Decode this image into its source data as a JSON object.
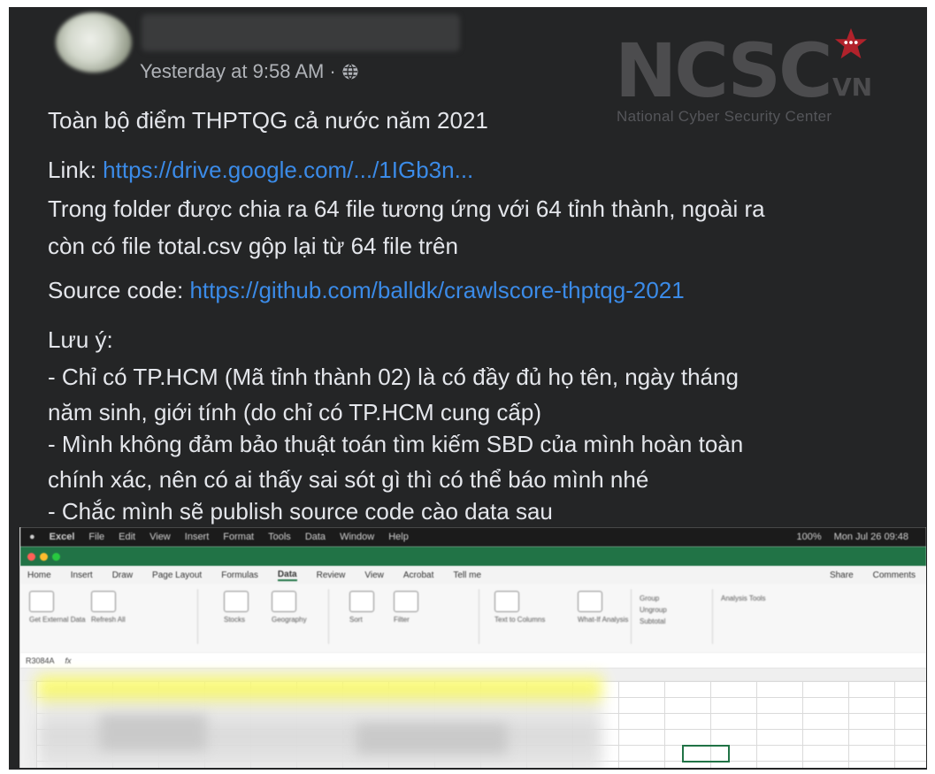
{
  "post": {
    "timestamp": "Yesterday at 9:58 AM",
    "separator": "·",
    "audience_icon": "globe-icon",
    "title_line": "Toàn bộ điểm THPTQG cả nước năm 2021",
    "link_label": "Link: ",
    "link_url": "https://drive.google.com/.../1IGb3n...",
    "folder_line1": "Trong folder được chia ra 64 file tương ứng với 64 tỉnh thành, ngoài ra",
    "folder_line2": "còn có file total.csv gộp lại từ 64 file trên",
    "source_label": "Source code: ",
    "source_url": "https://github.com/balldk/crawlscore-thptqg-2021",
    "note_heading": "Lưu ý:",
    "note_lines": [
      "- Chỉ có TP.HCM (Mã tỉnh thành 02) là có đầy đủ họ tên, ngày tháng",
      "năm sinh, giới tính (do chỉ có TP.HCM cung cấp)",
      "- Mình không đảm bảo thuật toán tìm kiếm SBD của mình hoàn toàn",
      "chính xác, nên có ai thấy sai sót gì thì có thể báo mình nhé",
      "- Chắc mình sẽ publish source code cào data sau"
    ]
  },
  "watermark": {
    "brand": "NCSC",
    "country": "VN",
    "subtitle": "National Cyber Security Center"
  },
  "excel": {
    "menu": [
      "Excel",
      "File",
      "Edit",
      "View",
      "Insert",
      "Format",
      "Tools",
      "Data",
      "Window",
      "Help"
    ],
    "menu_right": [
      "100%",
      "Mon Jul 26 09:48"
    ],
    "ribbon_tabs": [
      "Home",
      "Insert",
      "Draw",
      "Page Layout",
      "Formulas",
      "Data",
      "Review",
      "View",
      "Acrobat",
      "Tell me"
    ],
    "active_tab": "Data",
    "share": "Share",
    "comments": "Comments",
    "ribbon_groups": [
      "Get External Data",
      "Refresh All",
      "Stocks",
      "Geography",
      "Sort",
      "Filter",
      "Text to Columns",
      "What-If Analysis",
      "Group",
      "Ungroup",
      "Subtotal",
      "Analysis Tools"
    ],
    "name_box": "R3084A",
    "fx": "fx",
    "colors": {
      "excel_green": "#217346",
      "highlight": "#fdfd6a"
    }
  },
  "colors": {
    "post_bg": "#242526",
    "text": "#e4e6eb",
    "meta": "#b0b3b8",
    "link": "#3b8be8"
  }
}
